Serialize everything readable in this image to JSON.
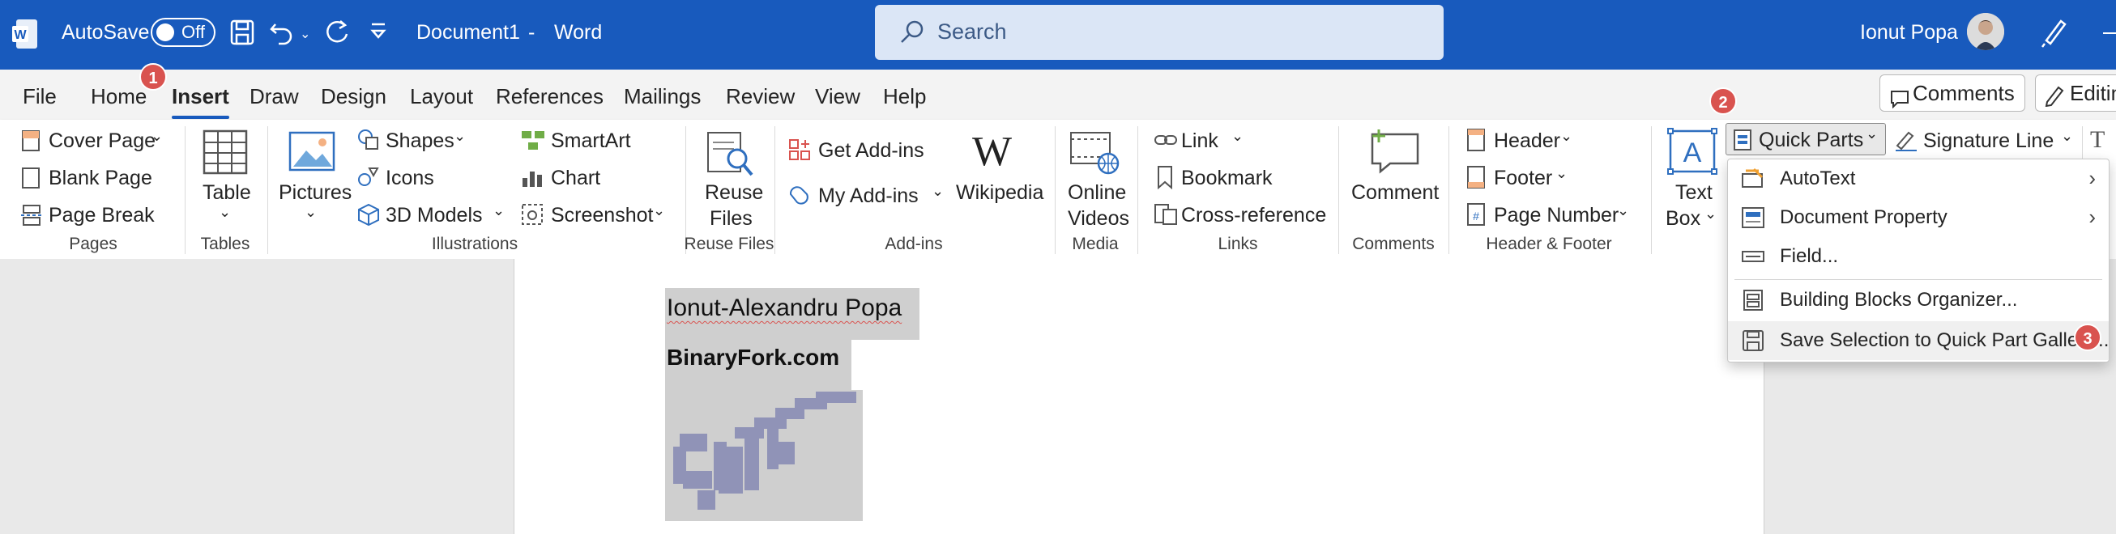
{
  "titlebar": {
    "autosave_label": "AutoSave",
    "autosave_state": "Off",
    "doc_title": "Document1",
    "separator": "-",
    "app_name": "Word",
    "search_placeholder": "Search",
    "user_name": "Ionut Popa"
  },
  "tabs": [
    {
      "label": "File"
    },
    {
      "label": "Home"
    },
    {
      "label": "Insert"
    },
    {
      "label": "Draw"
    },
    {
      "label": "Design"
    },
    {
      "label": "Layout"
    },
    {
      "label": "References"
    },
    {
      "label": "Mailings"
    },
    {
      "label": "Review"
    },
    {
      "label": "View"
    },
    {
      "label": "Help"
    }
  ],
  "active_tab": "Insert",
  "top_buttons": {
    "comments": "Comments",
    "editing": "Editin"
  },
  "badges": {
    "one": "1",
    "two": "2",
    "three": "3"
  },
  "ribbon": {
    "pages": {
      "cover_page": "Cover Page",
      "blank_page": "Blank Page",
      "page_break": "Page Break",
      "group": "Pages"
    },
    "tables": {
      "table": "Table",
      "group": "Tables"
    },
    "illustrations": {
      "pictures": "Pictures",
      "shapes": "Shapes",
      "icons": "Icons",
      "models_3d": "3D Models",
      "smartart": "SmartArt",
      "chart": "Chart",
      "screenshot": "Screenshot",
      "group": "Illustrations"
    },
    "reuse_files": {
      "reuse": "Reuse",
      "files": "Files",
      "group": "Reuse Files"
    },
    "addins": {
      "get_addins": "Get Add-ins",
      "my_addins": "My Add-ins",
      "wikipedia": "Wikipedia",
      "group": "Add-ins"
    },
    "media": {
      "online": "Online",
      "videos": "Videos",
      "group": "Media"
    },
    "links": {
      "link": "Link",
      "bookmark": "Bookmark",
      "cross_reference": "Cross-reference",
      "group": "Links"
    },
    "comments": {
      "comment": "Comment",
      "group": "Comments"
    },
    "header_footer": {
      "header": "Header",
      "footer": "Footer",
      "page_number": "Page Number",
      "group": "Header & Footer"
    },
    "text": {
      "text": "Text",
      "box": "Box",
      "quick_parts": "Quick Parts",
      "signature_line": "Signature Line"
    }
  },
  "quick_parts_menu": [
    {
      "label": "AutoText",
      "submenu": true
    },
    {
      "label": "Document Property",
      "submenu": true
    },
    {
      "label": "Field...",
      "submenu": false
    },
    {
      "label": "Building Blocks Organizer...",
      "submenu": false
    },
    {
      "label": "Save Selection to Quick Part Gallery...",
      "submenu": false
    }
  ],
  "document": {
    "line1": "Ionut-Alexandru Popa",
    "line2": "BinaryFork.com"
  },
  "colors": {
    "title_bar": "#185abd",
    "accent": "#185abd",
    "badge": "#d9534f",
    "selection": "#cfcfcf"
  }
}
